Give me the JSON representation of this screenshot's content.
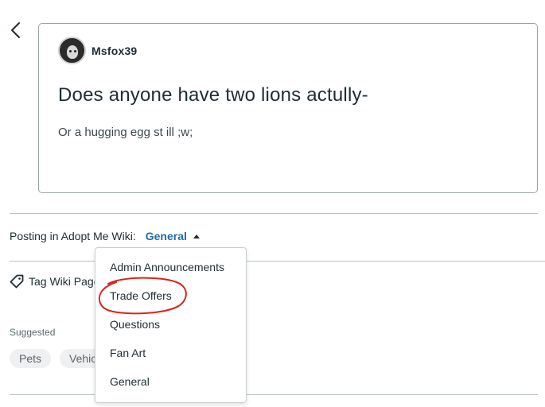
{
  "post": {
    "author": "Msfox39",
    "title": "Does anyone have two lions actully-",
    "body": "Or a hugging egg st ill ;w;"
  },
  "posting": {
    "prefix": "Posting in Adopt Me Wiki:",
    "category": "General"
  },
  "tag": {
    "label": "Tag Wiki Page"
  },
  "suggested": {
    "label": "Suggested",
    "chips": [
      "Pets",
      "Vehicles"
    ]
  },
  "dropdown": {
    "items": [
      "Admin Announcements",
      "Trade Offers",
      "Questions",
      "Fan Art",
      "General"
    ]
  },
  "colors": {
    "link": "#1a6fa5",
    "annotation": "#d9251c"
  }
}
